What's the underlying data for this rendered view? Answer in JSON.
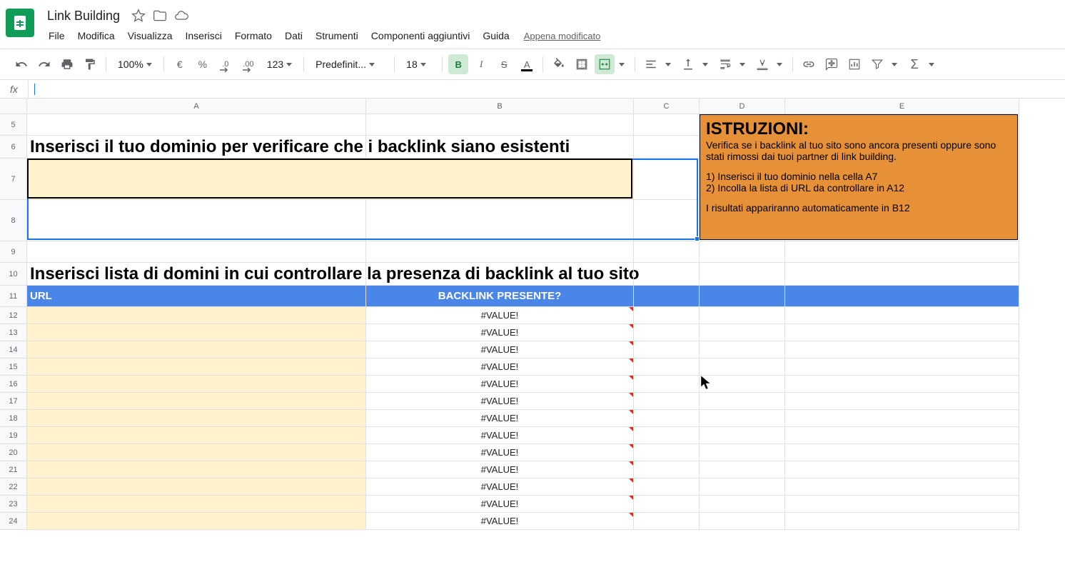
{
  "doc": {
    "title": "Link Building"
  },
  "menu": {
    "file": "File",
    "edit": "Modifica",
    "view": "Visualizza",
    "insert": "Inserisci",
    "format": "Formato",
    "data": "Dati",
    "tools": "Strumenti",
    "addons": "Componenti aggiuntivi",
    "help": "Guida",
    "last_edit": "Appena modificato"
  },
  "toolbar": {
    "zoom": "100%",
    "currency": "€",
    "percent": "%",
    "dec_dec": ".0",
    "inc_dec": ".00",
    "more_fmt": "123",
    "font": "Predefinit...",
    "font_size": "18"
  },
  "fx_label": "fx",
  "columns": [
    "A",
    "B",
    "C",
    "D",
    "E"
  ],
  "sheet": {
    "heading1": "Inserisci il tuo dominio per verificare che i backlink siano esistenti",
    "heading2": "Inserisci lista di domini in cui controllare la presenza di backlink al tuo sito",
    "instructions": {
      "title": "ISTRUZIONI:",
      "line1": "Verifica se i backlink al tuo sito sono ancora presenti oppure sono stati rimossi dai tuoi partner di link building.",
      "step1": "1) Inserisci il tuo dominio nella cella A7",
      "step2": "2) Incolla la lista di URL da controllare in A12",
      "line2": "I risultati appariranno automaticamente in B12"
    },
    "table": {
      "col_url": "URL",
      "col_backlink": "BACKLINK PRESENTE?"
    },
    "error_value": "#VALUE!",
    "row_labels": [
      "5",
      "6",
      "7",
      "8",
      "9",
      "10",
      "11",
      "12",
      "13",
      "14",
      "15",
      "16",
      "17",
      "18",
      "19",
      "20",
      "21",
      "22",
      "23",
      "24"
    ],
    "data_rows": [
      12,
      13,
      14,
      15,
      16,
      17,
      18,
      19,
      20,
      21,
      22,
      23,
      24
    ]
  }
}
